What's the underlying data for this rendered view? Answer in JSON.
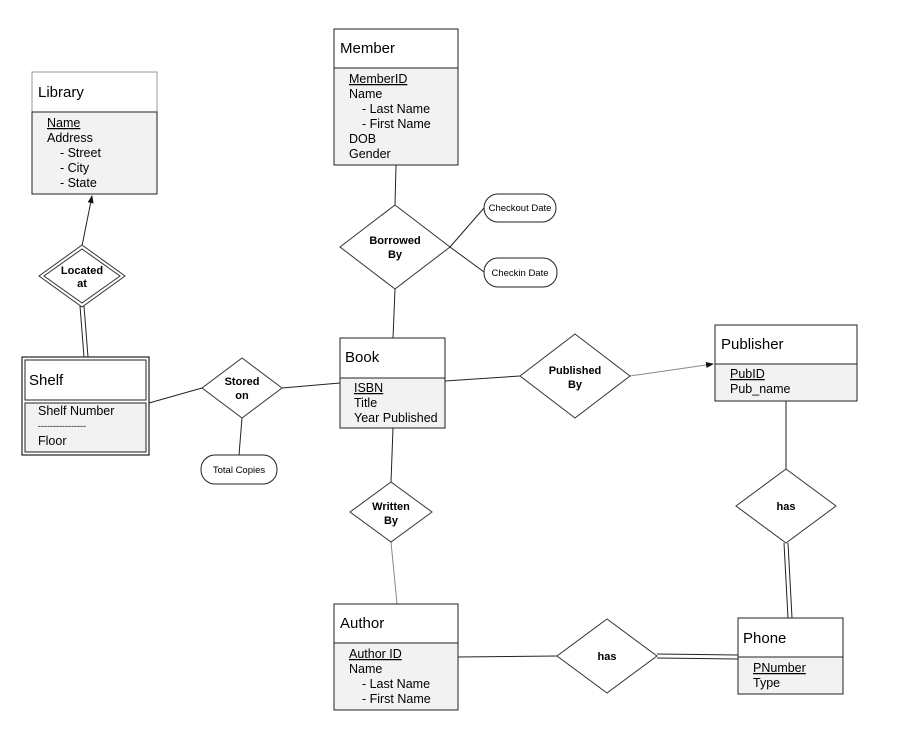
{
  "entities": {
    "library": {
      "title": "Library",
      "attrs": [
        "Name",
        "Address",
        "  - Street",
        "  - City",
        "  - State"
      ]
    },
    "member": {
      "title": "Member",
      "attrs": [
        "MemberID",
        "Name",
        "  - Last Name",
        "  - First Name",
        "DOB",
        "Gender"
      ]
    },
    "shelf": {
      "title": "Shelf",
      "attrs": [
        "Shelf Number",
        "----------------",
        "Floor"
      ]
    },
    "book": {
      "title": "Book",
      "attrs": [
        "ISBN",
        "Title",
        "Year Published"
      ]
    },
    "publisher": {
      "title": "Publisher",
      "attrs": [
        "PubID",
        "Pub_name"
      ]
    },
    "author": {
      "title": "Author",
      "attrs": [
        "Author ID",
        "Name",
        "  - Last Name",
        "  - First Name"
      ]
    },
    "phone": {
      "title": "Phone",
      "attrs": [
        "PNumber",
        "Type"
      ]
    }
  },
  "relationships": {
    "located_at": [
      "Located",
      "at"
    ],
    "borrowed_by": [
      "Borrowed",
      "By"
    ],
    "stored_on": [
      "Stored",
      "on"
    ],
    "published_by": [
      "Published",
      "By"
    ],
    "written_by": [
      "Written",
      "By"
    ],
    "publisher_has": [
      "has"
    ],
    "author_has": [
      "has"
    ]
  },
  "attributes": {
    "checkout_date": "Checkout Date",
    "checkin_date": "Checkin Date",
    "total_copies": "Total Copies"
  }
}
